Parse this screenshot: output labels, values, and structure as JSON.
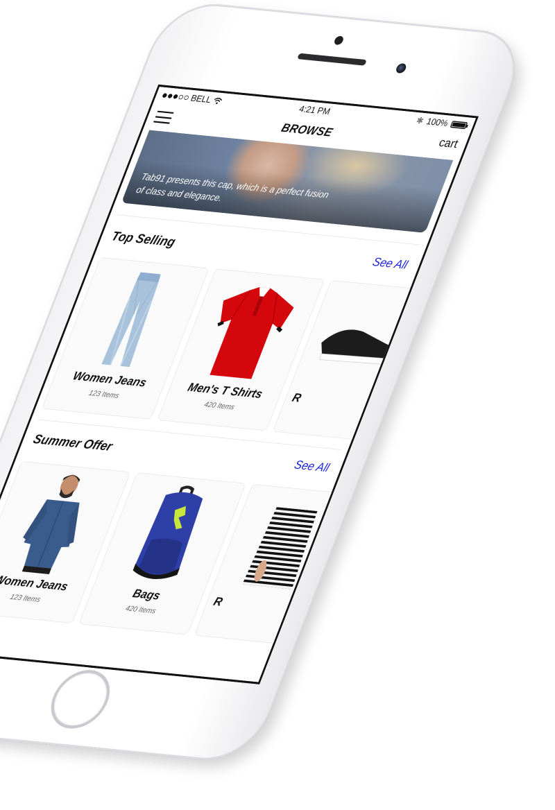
{
  "status_bar": {
    "carrier": "BELL",
    "time": "4:21 PM",
    "battery": "100%",
    "signal_bars": 3
  },
  "nav": {
    "title": "BROWSE",
    "cart": "cart",
    "menu_icon": "hamburger-menu-icon"
  },
  "hero": {
    "caption": "Tab91 presents this cap, which is a perfect fusion of class and elegance."
  },
  "sections": [
    {
      "title": "Top Selling",
      "see_all": "See All",
      "products": [
        {
          "name": "Women Jeans",
          "count": "123 Items",
          "image": "jeans"
        },
        {
          "name": "Men's T Shirts",
          "count": "420 Items",
          "image": "red-polo-shirt"
        },
        {
          "name": "R",
          "count": "",
          "image": "sneaker"
        }
      ]
    },
    {
      "title": "Summer Offer",
      "see_all": "See All",
      "products": [
        {
          "name": "Women Jeans",
          "count": "123 Items",
          "image": "man-denim-shirt"
        },
        {
          "name": "Bags",
          "count": "420 Items",
          "image": "blue-backpack"
        },
        {
          "name": "R",
          "count": "",
          "image": "striped-top"
        }
      ]
    }
  ],
  "colors": {
    "link": "#1a22d8",
    "text": "#111111",
    "card_border": "#e4e4e4",
    "polo_red": "#d4070c",
    "backpack_blue": "#2f3fa8",
    "backpack_accent": "#c8e63a"
  }
}
